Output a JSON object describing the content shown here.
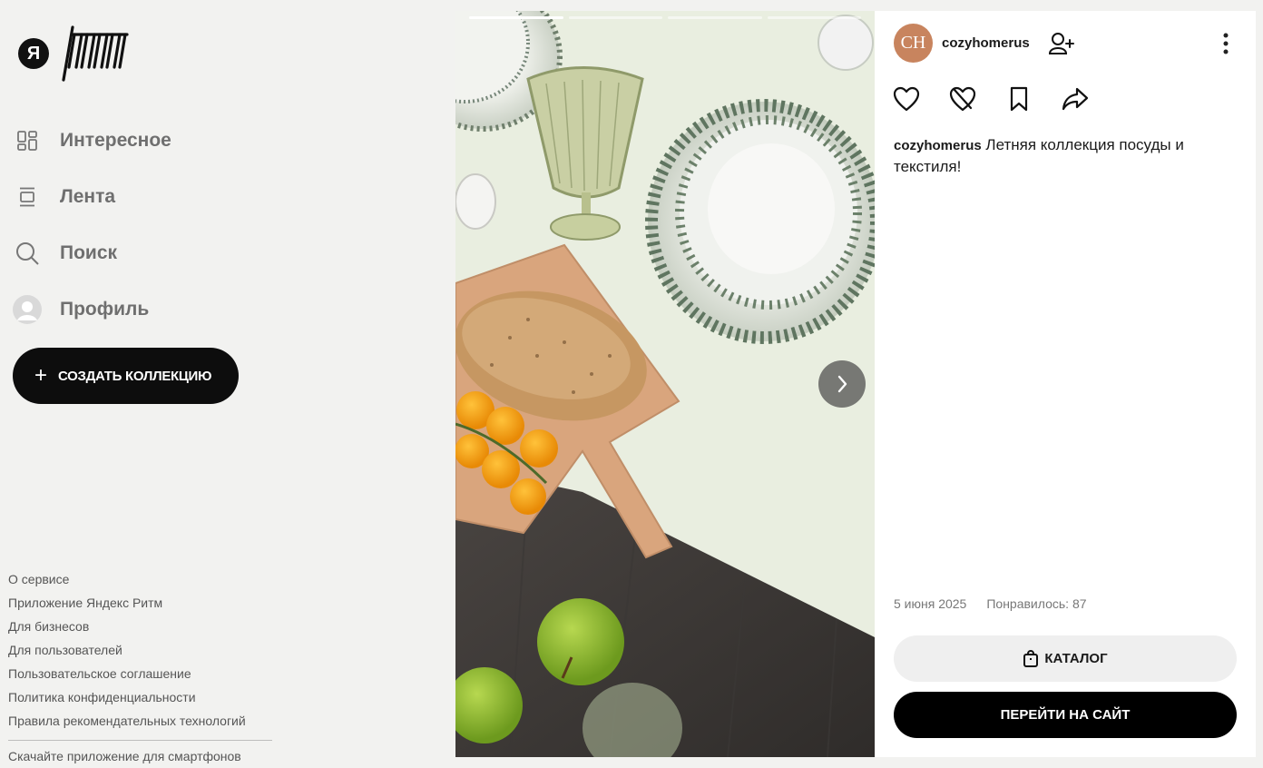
{
  "brand": {
    "logo_letter": "Я",
    "logo_name": "Ритм"
  },
  "sidebar": {
    "items": [
      {
        "label": "Интересное",
        "icon": "grid-icon"
      },
      {
        "label": "Лента",
        "icon": "feed-icon"
      },
      {
        "label": "Поиск",
        "icon": "search-icon"
      },
      {
        "label": "Профиль",
        "icon": "profile-avatar-icon"
      }
    ],
    "create_label": "СОЗДАТЬ КОЛЛЕКЦИЮ",
    "create_icon": "plus-icon"
  },
  "footer": {
    "links": [
      "О сервисе",
      "Приложение Яндекс Ритм",
      "Для бизнесов",
      "Для пользователей",
      "Пользовательское соглашение",
      "Политика конфиденциальности",
      "Правила рекомендательных технологий"
    ],
    "app_text": "Скачайте приложение для смартфонов"
  },
  "media": {
    "progress_segments": 4,
    "active_segment": 1,
    "next_icon": "chevron-right-icon"
  },
  "post": {
    "author": "cozyhomerus",
    "avatar_initials": "CH",
    "avatar_color": "#c8845e",
    "caption_author": "cozyhomerus",
    "caption_text": " Летняя коллекция посуды и текстиля!",
    "date": "5 июня 2025",
    "likes": "Понравилось: 87",
    "catalog_label": "КАТАЛОГ",
    "site_label": "ПЕРЕЙТИ НА САЙТ"
  },
  "colors": {
    "sidebar_bg": "#f2f2f0",
    "primary_button": "#0d0d0d",
    "secondary_button": "#efefef"
  }
}
